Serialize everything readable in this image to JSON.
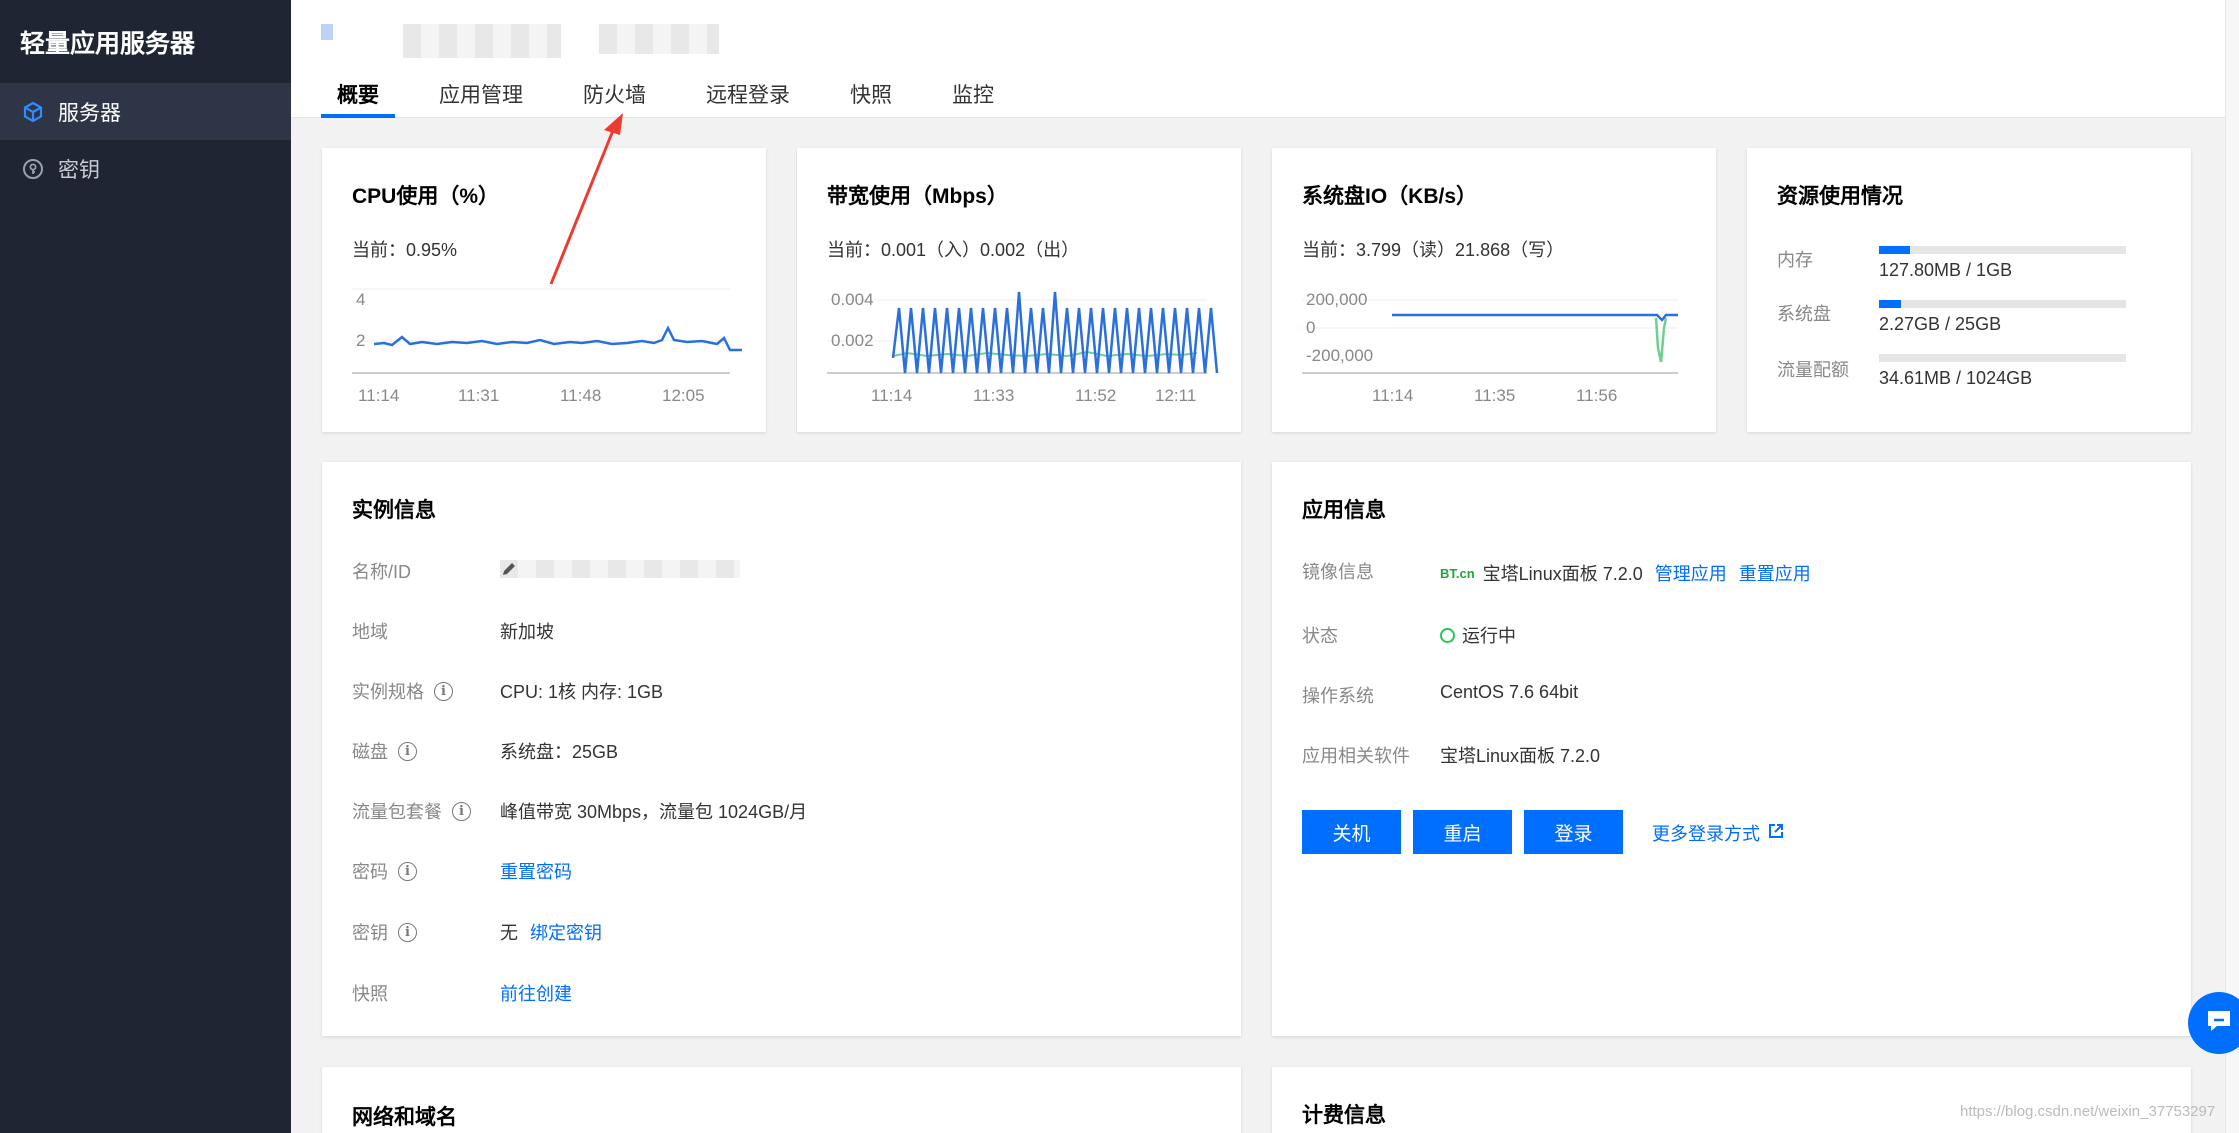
{
  "sidebar": {
    "title": "轻量应用服务器",
    "items": [
      {
        "label": "服务器",
        "icon": "cube-icon"
      },
      {
        "label": "密钥",
        "icon": "key-icon"
      }
    ]
  },
  "tabs": [
    "概要",
    "应用管理",
    "防火墙",
    "远程登录",
    "快照",
    "监控"
  ],
  "cpu": {
    "title": "CPU使用（%）",
    "current": "当前：0.95%",
    "y_ticks": [
      "4",
      "2"
    ],
    "x_ticks": [
      "11:14",
      "11:31",
      "11:48",
      "12:05"
    ]
  },
  "bandwidth": {
    "title": "带宽使用（Mbps）",
    "current": "当前：0.001（入）0.002（出）",
    "y_ticks": [
      "0.004",
      "0.002"
    ],
    "x_ticks": [
      "11:14",
      "11:33",
      "11:52",
      "12:11"
    ]
  },
  "disk_io": {
    "title": "系统盘IO（KB/s）",
    "current": "当前：3.799（读）21.868（写）",
    "y_ticks": [
      "200,000",
      "0",
      "-200,000"
    ],
    "x_ticks": [
      "11:14",
      "11:35",
      "11:56"
    ]
  },
  "resources": {
    "title": "资源使用情况",
    "rows": [
      {
        "label": "内存",
        "value": "127.80MB / 1GB",
        "fraction": 0.124
      },
      {
        "label": "系统盘",
        "value": "2.27GB / 25GB",
        "fraction": 0.091
      },
      {
        "label": "流量配额",
        "value": "34.61MB / 1024GB",
        "fraction": 0.0
      }
    ]
  },
  "instance": {
    "title": "实例信息",
    "name_label": "名称/ID",
    "region_label": "地域",
    "region_value": "新加坡",
    "spec_label": "实例规格",
    "spec_value": "CPU: 1核 内存: 1GB",
    "disk_label": "磁盘",
    "disk_value": "系统盘：25GB",
    "traffic_label": "流量包套餐",
    "traffic_value": "峰值带宽 30Mbps，流量包 1024GB/月",
    "password_label": "密码",
    "password_link": "重置密码",
    "key_label": "密钥",
    "key_value": "无",
    "key_link": "绑定密钥",
    "snapshot_label": "快照",
    "snapshot_link": "前往创建"
  },
  "app": {
    "title": "应用信息",
    "image_label": "镜像信息",
    "image_logo": "BT.cn",
    "image_value": "宝塔Linux面板 7.2.0",
    "manage_link": "管理应用",
    "reset_link": "重置应用",
    "status_label": "状态",
    "status_value": "运行中",
    "os_label": "操作系统",
    "os_value": "CentOS 7.6 64bit",
    "software_label": "应用相关软件",
    "software_value": "宝塔Linux面板 7.2.0",
    "buttons": {
      "shutdown": "关机",
      "restart": "重启",
      "login": "登录"
    },
    "more_login": "更多登录方式"
  },
  "network": {
    "title": "网络和域名"
  },
  "billing": {
    "title": "计费信息"
  },
  "watermark": "https://blog.csdn.net/weixin_37753297",
  "colors": {
    "accent": "#006eff",
    "sidebar": "#1f2533",
    "success": "#2bc45c",
    "arrow": "#ee3b30"
  }
}
